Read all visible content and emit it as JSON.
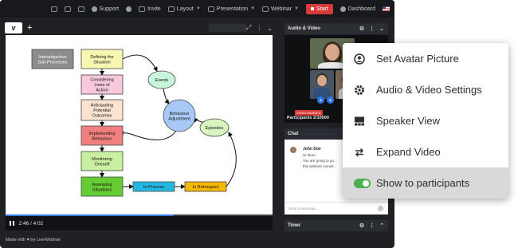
{
  "topbar": {
    "support": "Support",
    "invite": "Invite",
    "layout": "Layout",
    "presentation": "Presentation",
    "webinar": "Webinar",
    "start": "Start",
    "dashboard": "Dashboard"
  },
  "presentation": {
    "tab_label": "v",
    "add_tab": "+",
    "time": "2:46 / 4:02",
    "progress_fraction": 0.63,
    "made_with": "Made with ♥ by LiveWebinar"
  },
  "diagram": {
    "nodes": {
      "intersubjective": "Intersubjective Sub-Processes",
      "defining": "Defining the Situation",
      "considering": "Considering Lines of Action",
      "anticipating": "Anticipating Potential Outcomes",
      "implementing": "Implementing Behaviour",
      "monitoring": "Monitoring Oneself",
      "assessing": "Assessing Situations",
      "in_process": "In Process",
      "in_retrospect": "In Retrospect",
      "events": "Events",
      "behaviour_adjustment": "Behaviour Adjustment",
      "episodes": "Episodes"
    },
    "colors": {
      "gray": "#8c8c8c",
      "defining": "#f7f7b2",
      "considering": "#f8c8dc",
      "anticipating": "#fbe3cf",
      "implementing": "#f08080",
      "monitoring": "#c8f0a0",
      "assessing": "#66cc33",
      "in_process": "#22b8e0",
      "in_retrospect": "#f5b800",
      "events": "#c8f5dc",
      "behaviour_adjustment": "#a8c8f5",
      "episodes": "#d8f5c0"
    }
  },
  "audio_video": {
    "title": "Audio & Video",
    "live_tag": "VIDEO MARKED",
    "participants": "Participants 2/10000"
  },
  "chat": {
    "title": "Chat",
    "message": {
      "name": "John Doe",
      "lines": [
        "Hi there",
        "You are going to pu...",
        "this webinar someti..."
      ]
    },
    "placeholder": "Send a message..."
  },
  "timer": {
    "title": "Timer"
  },
  "context_menu": {
    "items": [
      {
        "label": "Set Avatar Picture",
        "icon": "avatar-icon"
      },
      {
        "label": "Audio & Video Settings",
        "icon": "gear-icon"
      },
      {
        "label": "Speaker View",
        "icon": "speaker-view-icon"
      },
      {
        "label": "Expand Video",
        "icon": "expand-icon"
      },
      {
        "label": "Show to participants",
        "icon": "toggle-switch"
      }
    ],
    "show_to_participants_enabled": true
  }
}
